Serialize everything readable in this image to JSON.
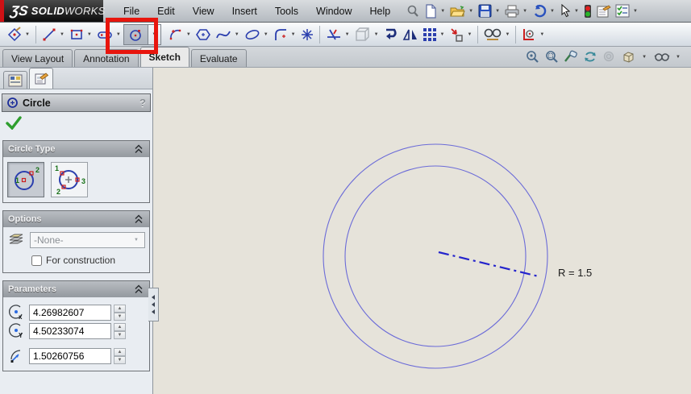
{
  "titlebar": {
    "logo": {
      "mark": "ƷS",
      "brand_bold": "SOLID",
      "brand_rest": "WORKS"
    },
    "menus": [
      "File",
      "Edit",
      "View",
      "Insert",
      "Tools",
      "Window",
      "Help"
    ],
    "standard_icons": [
      "search",
      "new-document",
      "open",
      "save",
      "print",
      "undo",
      "select-cursor",
      "stoplight",
      "properties",
      "options"
    ]
  },
  "sketch_toolbar": {
    "icons": [
      "sketch",
      "line",
      "rectangle",
      "slot",
      "circle",
      "arc",
      "polygon",
      "spline",
      "ellipse",
      "fillet",
      "point",
      "trim",
      "convert-entities",
      "offset-entities",
      "mirror-entities",
      "linear-sketch-pattern",
      "move-entities",
      "display-delete-relations",
      "quick-snaps"
    ],
    "active_tool": "circle",
    "highlight_color": "#e8150d"
  },
  "tab_bar": {
    "tabs": [
      "View Layout",
      "Annotation",
      "Sketch",
      "Evaluate"
    ],
    "active_tab": "Sketch"
  },
  "view_toolbar": {
    "icons": [
      "zoom-fit",
      "zoom-area",
      "zoom-selection",
      "rotate-view",
      "pan",
      "view-orientation",
      "display-style"
    ]
  },
  "property_manager": {
    "title": "Circle",
    "circle_type": {
      "title": "Circle Type",
      "buttons": [
        {
          "name": "center-circle",
          "selected": true,
          "points": [
            "1",
            "2"
          ]
        },
        {
          "name": "perimeter-circle",
          "selected": false,
          "points": [
            "1",
            "2",
            "3"
          ]
        }
      ]
    },
    "options": {
      "title": "Options",
      "layer_value": "-None-",
      "construction_label": "For construction",
      "construction_checked": false
    },
    "parameters": {
      "title": "Parameters",
      "center_x": "4.26982607",
      "center_y": "4.50233074",
      "radius": "1.50260756"
    }
  },
  "canvas": {
    "dimension_label": "R = 1.5",
    "entity_color": "#6b6bd8",
    "centerline_color": "#2424cc",
    "background": "#e6e3da"
  },
  "ui": {
    "dropdown_glyph": "▼",
    "spinner_up": "▲",
    "spinner_down": "▼",
    "help_glyph": "?"
  }
}
